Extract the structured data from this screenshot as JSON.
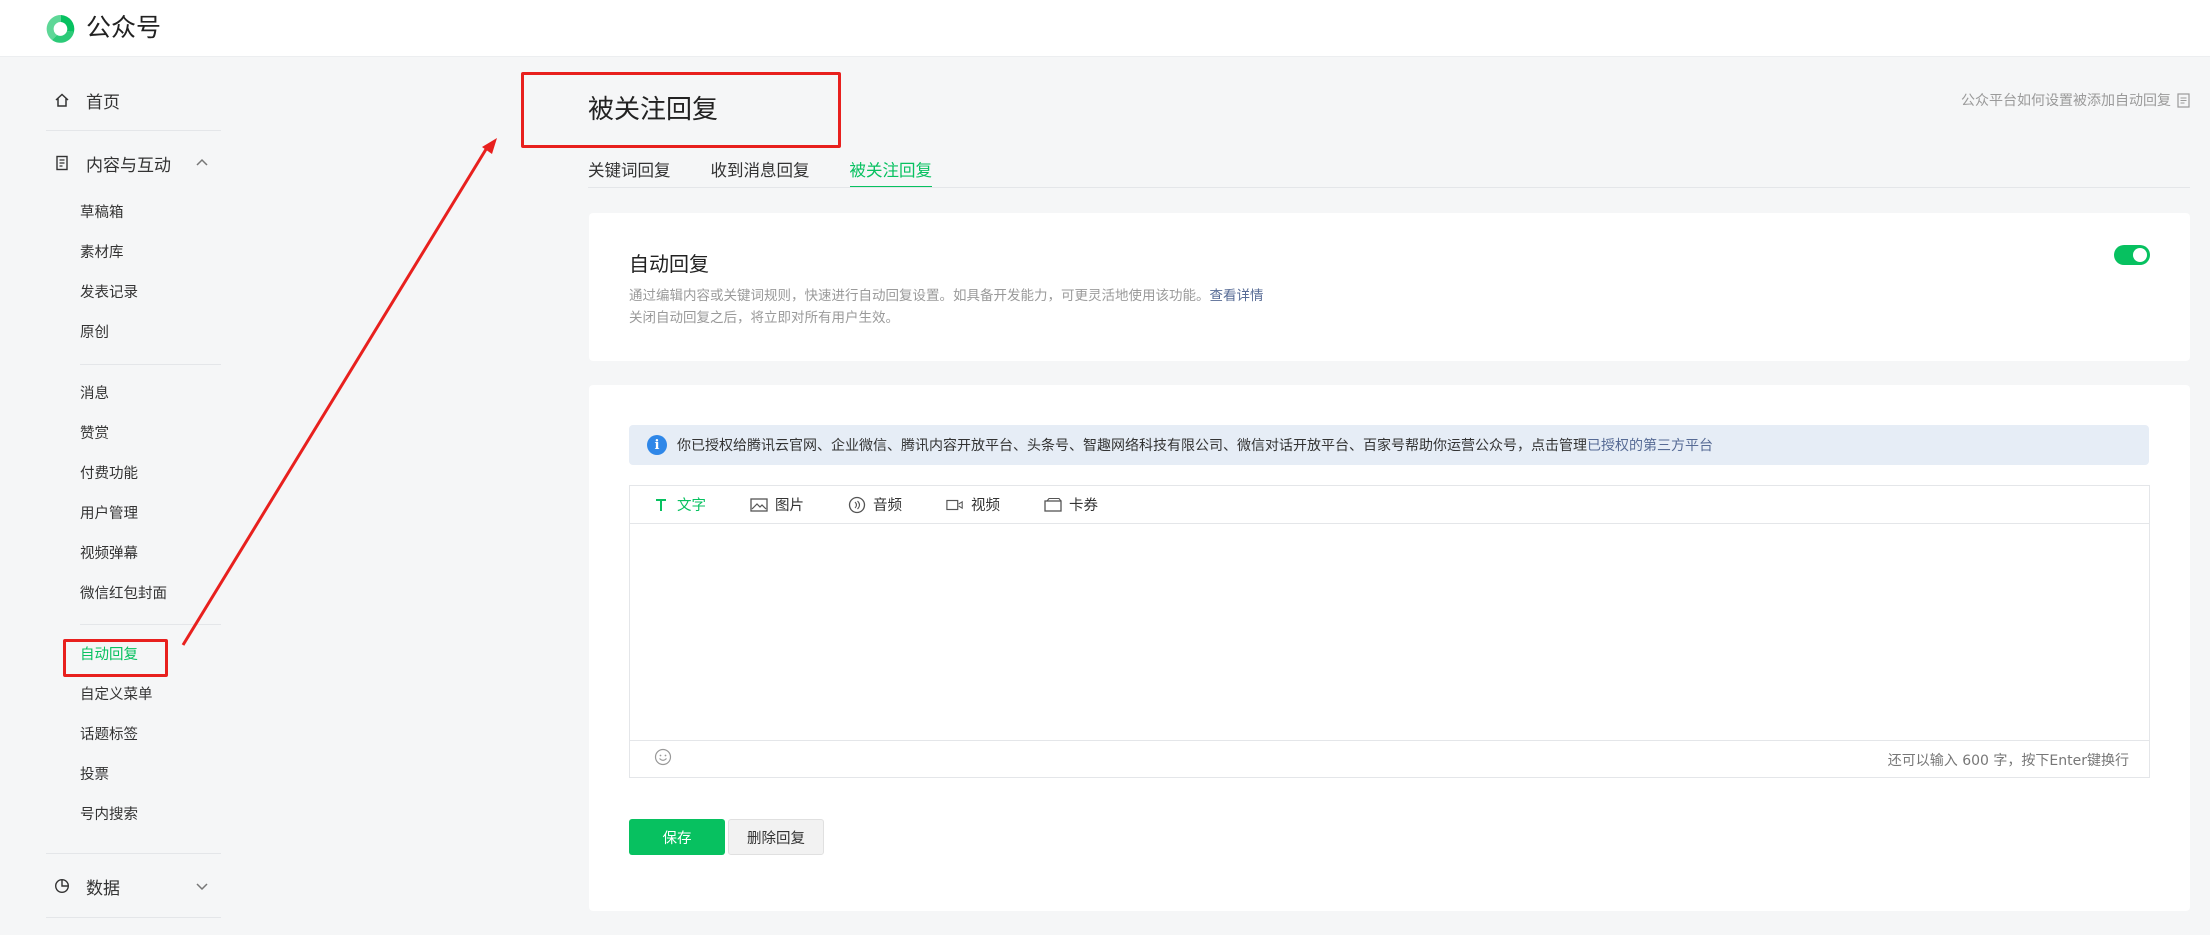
{
  "header": {
    "brand": "公众号"
  },
  "sidebar": {
    "home": "首页",
    "content_group": "内容与互动",
    "content_items": [
      "草稿箱",
      "素材库",
      "发表记录",
      "原创"
    ],
    "interaction_items": [
      "消息",
      "赞赏",
      "付费功能",
      "用户管理",
      "视频弹幕",
      "微信红包封面"
    ],
    "feature_items": [
      "自动回复",
      "自定义菜单",
      "话题标签",
      "投票",
      "号内搜索"
    ],
    "data_group": "数据"
  },
  "main": {
    "title": "被关注回复",
    "help_link": "公众平台如何设置被添加自动回复",
    "tabs": [
      "关键词回复",
      "收到消息回复",
      "被关注回复"
    ],
    "auto_reply": {
      "title": "自动回复",
      "desc_line1": "通过编辑内容或关键词规则，快速进行自动回复设置。如具备开发能力，可更灵活地使用该功能。",
      "desc_link": "查看详情",
      "desc_line2": "关闭自动回复之后，将立即对所有用户生效。",
      "enabled": true
    },
    "notice": {
      "text": "你已授权给腾讯云官网、企业微信、腾讯内容开放平台、头条号、智趣网络科技有限公司、微信对话开放平台、百家号帮助你运营公众号，点击管理",
      "link": "已授权的第三方平台"
    },
    "editor_tabs": [
      "文字",
      "图片",
      "音频",
      "视频",
      "卡券"
    ],
    "counter": "还可以输入 600 字，按下Enter键换行",
    "save": "保存",
    "delete": "删除回复"
  },
  "colors": {
    "accent": "#07c160",
    "annotation": "#e8201e",
    "link": "#576b95",
    "info": "#2f87e8"
  }
}
